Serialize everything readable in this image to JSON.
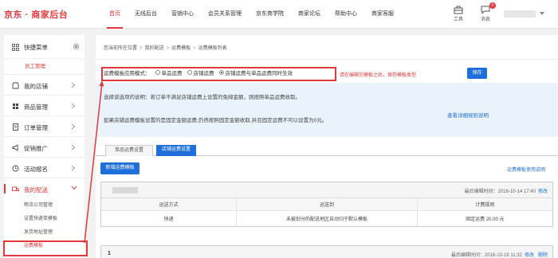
{
  "header": {
    "logo": "京东 · 商家后台",
    "nav": [
      "首页",
      "无线后台",
      "营销中心",
      "会员关系管理",
      "京东商学院",
      "商家论坛",
      "帮助中心",
      "商家客服"
    ],
    "active_nav": "首页",
    "tools": [
      {
        "label": "工具",
        "icon": "toolbox-icon"
      },
      {
        "label": "消息",
        "icon": "message-icon",
        "badge": "0"
      }
    ]
  },
  "sidebar": {
    "quick_menu": "快捷菜单",
    "staff_mgmt": "员工管理",
    "items": [
      {
        "label": "我的店铺",
        "icon": "store-icon"
      },
      {
        "label": "商品管理",
        "icon": "goods-icon"
      },
      {
        "label": "订单管理",
        "icon": "order-icon"
      },
      {
        "label": "促销推广",
        "icon": "promotion-icon"
      },
      {
        "label": "活动报名",
        "icon": "activity-icon"
      }
    ],
    "open_item": {
      "label": "我的配送",
      "icon": "delivery-icon"
    },
    "sub_items": [
      "物流公司管理",
      "设置快递单模板",
      "发货地址管理",
      "运费模板"
    ],
    "active_sub": "运费模板"
  },
  "breadcrumb": [
    "您当前所在位置",
    "我的配送",
    "运费模板",
    "运费模板列表"
  ],
  "mode": {
    "label": "运费模板应用模式：",
    "options": [
      "单品运费",
      "店铺运费",
      "店铺运费与单品运费同时生效"
    ],
    "selected": "店铺运费与单品运费同时生效",
    "hint": "请在编辑完模板之后，保存模板类型",
    "save": "保存"
  },
  "info": {
    "line1": "选择该选项的说明：若订单不满足店铺运费上设置的免邮金额，则按照单品运费收取。",
    "line2": "如果店铺运费模板设置的是固定金额运费,仍然按照固定金额收取,并且固定运费不可以设置为0元。",
    "detail_link": "查看详细规则说明"
  },
  "tabs": [
    "单品运费设置",
    "店铺运费设置"
  ],
  "active_tab": "店铺运费设置",
  "actions": {
    "new_template": "新增运费模板",
    "help_link": "运费模板使用说明"
  },
  "templates": [
    {
      "name": "",
      "last_edit_label": "最后编辑时间：",
      "last_edit": "2016-10-14 17:40",
      "edit": "修改",
      "columns": [
        "运送方式",
        "运送到",
        "计费规则"
      ],
      "rows": [
        [
          "快递",
          "未被划分的配送地区自动归于默认模板",
          "固定运费 20.00 元"
        ]
      ]
    },
    {
      "name": "1",
      "last_edit_label": "最后编辑时间：",
      "last_edit": "2016-10-18 11:32",
      "edit": "修改",
      "delete": "删除"
    }
  ],
  "colors": {
    "accent_red": "#e4393c",
    "primary_blue": "#1e6fd9",
    "info_bg": "#eaf2fb"
  }
}
